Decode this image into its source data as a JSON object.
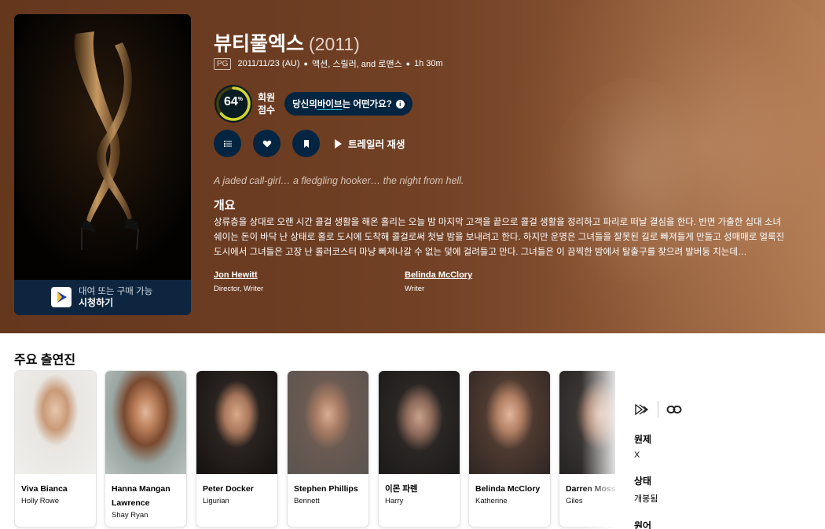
{
  "movie": {
    "title": "뷰티풀엑스",
    "year": "(2011)",
    "certification": "PG",
    "release": "2011/11/23 (AU)",
    "genres": "액션, 스릴러, and 로맨스",
    "runtime": "1h 30m",
    "score": "64",
    "score_unit": "%",
    "score_fraction": 0.64,
    "score_label_1": "회원",
    "score_label_2": "점수",
    "vibe_pre": "당신의 ",
    "vibe_hl": "바이브",
    "vibe_post": "는 어떤가요?",
    "trailer_label": "트레일러 재생",
    "tagline": "A jaded call-girl… a fledgling hooker… the night from hell.",
    "overview_heading": "개요",
    "overview": "상류층을 상대로 오랜 시간 콜걸 생활을 해온 홀리는 오늘 밤 마지막 고객을 끝으로 콜걸 생활을 정리하고 파리로 떠날 결심을 한다. 반면 가출한 십대 소녀 쉐이는 돈이 바닥 난 상태로 홀로 도시에 도착해 콜걸로써 첫날 밤을 보내려고 한다. 하지만 운명은 그녀들을 잘못된 길로 빠져들게 만들고 성매매로 얼룩진 도시에서 그녀들은 고장 난 롤러코스터 마냥 빠져나갈 수 없는 덫에 걸려들고 만다. 그녀들은 이 끔찍한 밤에서 탈출구를 찾으려 발버둥 치는데…",
    "crew": [
      {
        "name": "Jon Hewitt",
        "role": "Director, Writer"
      },
      {
        "name": "Belinda McClory",
        "role": "Writer"
      }
    ]
  },
  "watch": {
    "line1": "대여 또는 구매 가능",
    "line2": "시청하기"
  },
  "cast_heading": "주요 출연진",
  "cast": [
    {
      "name": "Viva Bianca",
      "character": "Holly Rowe"
    },
    {
      "name": "Hanna Mangan Lawrence",
      "character": "Shay Ryan"
    },
    {
      "name": "Peter Docker",
      "character": "Ligurian"
    },
    {
      "name": "Stephen Phillips",
      "character": "Bennett"
    },
    {
      "name": "이몬 파렌",
      "character": "Harry"
    },
    {
      "name": "Belinda McClory",
      "character": "Katherine"
    },
    {
      "name": "Darren Moss",
      "character": "Giles"
    }
  ],
  "facts": [
    {
      "label": "원제",
      "value": "X"
    },
    {
      "label": "상태",
      "value": "개봉됨"
    },
    {
      "label": "원어",
      "value": ""
    }
  ],
  "colors": {
    "navy": "#032541",
    "score_ring": "#d2d531",
    "accent": "#37c3d6"
  }
}
